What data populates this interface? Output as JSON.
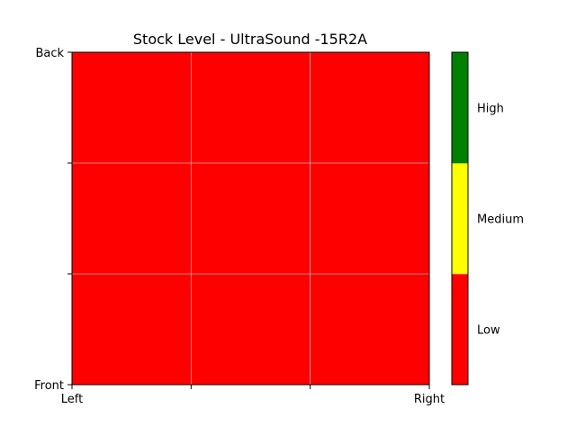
{
  "chart_data": {
    "type": "heatmap",
    "title": "Stock Level - UltraSound -15R2A",
    "xlabel": "",
    "ylabel": "",
    "x_ticks": [
      "Left",
      "",
      "",
      "Right"
    ],
    "y_ticks": [
      "Back",
      "",
      "",
      "Front"
    ],
    "rows": 3,
    "cols": 3,
    "grid": true,
    "values": [
      [
        "Low",
        "Low",
        "Low"
      ],
      [
        "Low",
        "Low",
        "Low"
      ],
      [
        "Low",
        "Low",
        "Low"
      ]
    ],
    "colorbar": {
      "levels": [
        "Low",
        "Medium",
        "High"
      ],
      "colors": [
        "#ff0000",
        "#ffff00",
        "#008000"
      ]
    }
  }
}
